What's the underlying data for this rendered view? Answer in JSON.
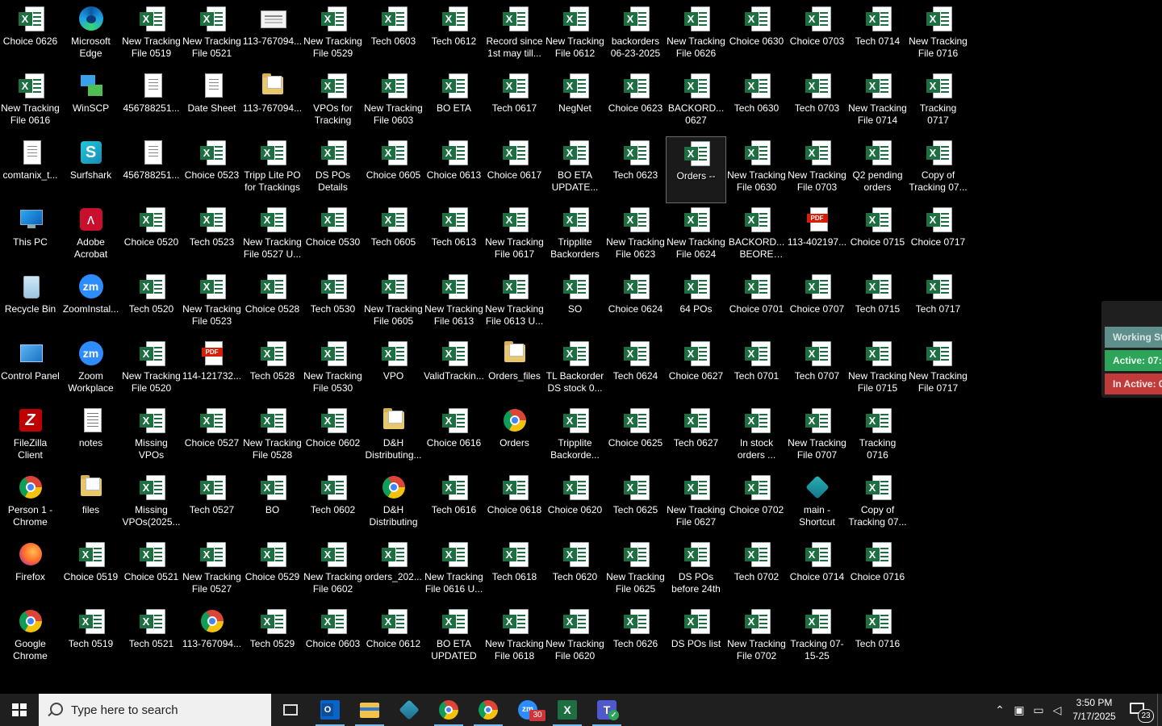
{
  "desktop": {
    "columns": [
      [
        {
          "label": "Choice 0626",
          "type": "excel"
        },
        {
          "label": "New Tracking File 0616",
          "type": "excel"
        },
        {
          "label": "comtanix_t...",
          "type": "file"
        },
        {
          "label": "This PC",
          "type": "pc"
        },
        {
          "label": "Recycle Bin",
          "type": "recycle"
        },
        {
          "label": "Control Panel",
          "type": "cp"
        },
        {
          "label": "FileZilla Client",
          "type": "fz"
        },
        {
          "label": "Person 1 - Chrome",
          "type": "chrome"
        },
        {
          "label": "Firefox",
          "type": "ff"
        },
        {
          "label": "Google Chrome",
          "type": "chrome"
        }
      ],
      [
        {
          "label": "Microsoft Edge",
          "type": "edge"
        },
        {
          "label": "WinSCP",
          "type": "winscp"
        },
        {
          "label": "Surfshark",
          "type": "surf"
        },
        {
          "label": "Adobe Acrobat",
          "type": "acrobat"
        },
        {
          "label": "ZoomInstal...",
          "type": "zoom"
        },
        {
          "label": "Zoom Workplace",
          "type": "zoom"
        },
        {
          "label": "notes",
          "type": "notes"
        },
        {
          "label": "files",
          "type": "folder"
        },
        {
          "label": "Choice 0519",
          "type": "excel"
        },
        {
          "label": "Tech 0519",
          "type": "excel"
        }
      ],
      [
        {
          "label": "New Tracking File 0519",
          "type": "excel"
        },
        {
          "label": "456788251...",
          "type": "file"
        },
        {
          "label": "456788251...",
          "type": "file"
        },
        {
          "label": "Choice 0520",
          "type": "excel"
        },
        {
          "label": "Tech 0520",
          "type": "excel"
        },
        {
          "label": "New Tracking File 0520",
          "type": "excel"
        },
        {
          "label": "Missing VPOs",
          "type": "excel"
        },
        {
          "label": "Missing VPOs(2025...",
          "type": "excel"
        },
        {
          "label": "Choice 0521",
          "type": "excel"
        },
        {
          "label": "Tech 0521",
          "type": "excel"
        }
      ],
      [
        {
          "label": "New Tracking File 0521",
          "type": "excel"
        },
        {
          "label": "Date Sheet",
          "type": "file"
        },
        {
          "label": "Choice 0523",
          "type": "excel"
        },
        {
          "label": "Tech 0523",
          "type": "excel"
        },
        {
          "label": "New Tracking File 0523",
          "type": "excel"
        },
        {
          "label": "114-121732...",
          "type": "pdf"
        },
        {
          "label": "Choice 0527",
          "type": "excel"
        },
        {
          "label": "Tech 0527",
          "type": "excel"
        },
        {
          "label": "New Tracking File 0527",
          "type": "excel"
        },
        {
          "label": "113-767094...",
          "type": "chrome"
        }
      ],
      [
        {
          "label": "113-767094...",
          "type": "img"
        },
        {
          "label": "113-767094...",
          "type": "folder"
        },
        {
          "label": "Tripp Lite PO for Trackings",
          "type": "excel"
        },
        {
          "label": "New Tracking File 0527 U...",
          "type": "excel"
        },
        {
          "label": "Choice 0528",
          "type": "excel"
        },
        {
          "label": "Tech 0528",
          "type": "excel"
        },
        {
          "label": "New Tracking File 0528",
          "type": "excel"
        },
        {
          "label": "BO",
          "type": "excel"
        },
        {
          "label": "Choice 0529",
          "type": "excel"
        },
        {
          "label": "Tech 0529",
          "type": "excel"
        }
      ],
      [
        {
          "label": "New Tracking File 0529",
          "type": "excel"
        },
        {
          "label": "VPOs for Tracking",
          "type": "excel"
        },
        {
          "label": "DS POs Details",
          "type": "excel"
        },
        {
          "label": "Choice 0530",
          "type": "excel"
        },
        {
          "label": "Tech 0530",
          "type": "excel"
        },
        {
          "label": "New Tracking File 0530",
          "type": "excel"
        },
        {
          "label": "Choice 0602",
          "type": "excel"
        },
        {
          "label": "Tech 0602",
          "type": "excel"
        },
        {
          "label": "New Tracking File 0602",
          "type": "excel"
        },
        {
          "label": "Choice 0603",
          "type": "excel"
        }
      ],
      [
        {
          "label": "Tech 0603",
          "type": "excel"
        },
        {
          "label": "New Tracking File 0603",
          "type": "excel"
        },
        {
          "label": "Choice 0605",
          "type": "excel"
        },
        {
          "label": "Tech 0605",
          "type": "excel"
        },
        {
          "label": "New Tracking File 0605",
          "type": "excel"
        },
        {
          "label": "VPO",
          "type": "excel"
        },
        {
          "label": "D&H Distributing...",
          "type": "folder"
        },
        {
          "label": "D&H Distributing",
          "type": "chrome"
        },
        {
          "label": "orders_202...",
          "type": "excel"
        },
        {
          "label": "Choice 0612",
          "type": "excel"
        }
      ],
      [
        {
          "label": "Tech 0612",
          "type": "excel"
        },
        {
          "label": "BO ETA",
          "type": "excel"
        },
        {
          "label": "Choice 0613",
          "type": "excel"
        },
        {
          "label": "Tech 0613",
          "type": "excel"
        },
        {
          "label": "New Tracking File 0613",
          "type": "excel"
        },
        {
          "label": "ValidTrackin...",
          "type": "excel"
        },
        {
          "label": "Choice 0616",
          "type": "excel"
        },
        {
          "label": "Tech 0616",
          "type": "excel"
        },
        {
          "label": "New Tracking File 0616 U...",
          "type": "excel"
        },
        {
          "label": "BO ETA UPDATED",
          "type": "excel"
        }
      ],
      [
        {
          "label": "Record since 1st may till...",
          "type": "excel"
        },
        {
          "label": "Tech 0617",
          "type": "excel"
        },
        {
          "label": "Choice 0617",
          "type": "excel"
        },
        {
          "label": "New Tracking File 0617",
          "type": "excel"
        },
        {
          "label": "New Tracking File 0613 U...",
          "type": "excel"
        },
        {
          "label": "Orders_files",
          "type": "folder"
        },
        {
          "label": "Orders",
          "type": "chrome"
        },
        {
          "label": "Choice 0618",
          "type": "excel"
        },
        {
          "label": "Tech 0618",
          "type": "excel"
        },
        {
          "label": "New Tracking File 0618",
          "type": "excel"
        }
      ],
      [
        {
          "label": "New Tracking File 0612",
          "type": "excel"
        },
        {
          "label": "NegNet",
          "type": "excel"
        },
        {
          "label": "BO ETA UPDATE...",
          "type": "excel"
        },
        {
          "label": "Tripplite Backorders",
          "type": "excel"
        },
        {
          "label": "SO",
          "type": "excel"
        },
        {
          "label": "TL Backorder DS stock 0...",
          "type": "excel"
        },
        {
          "label": "Tripplite Backorde...",
          "type": "excel"
        },
        {
          "label": "Choice 0620",
          "type": "excel"
        },
        {
          "label": "Tech 0620",
          "type": "excel"
        },
        {
          "label": "New Tracking File 0620",
          "type": "excel"
        }
      ],
      [
        {
          "label": "backorders 06-23-2025",
          "type": "excel"
        },
        {
          "label": "Choice 0623",
          "type": "excel"
        },
        {
          "label": "Tech 0623",
          "type": "excel"
        },
        {
          "label": "New Tracking File 0623",
          "type": "excel"
        },
        {
          "label": "Choice 0624",
          "type": "excel"
        },
        {
          "label": "Tech 0624",
          "type": "excel"
        },
        {
          "label": "Choice 0625",
          "type": "excel"
        },
        {
          "label": "Tech 0625",
          "type": "excel"
        },
        {
          "label": "New Tracking File 0625",
          "type": "excel"
        },
        {
          "label": "Tech 0626",
          "type": "excel"
        }
      ],
      [
        {
          "label": "New Tracking File 0626",
          "type": "excel"
        },
        {
          "label": "BACKORD... 0627",
          "type": "excel"
        },
        {
          "label": "Orders --",
          "type": "excel",
          "selected": true
        },
        {
          "label": "New Tracking File 0624",
          "type": "excel"
        },
        {
          "label": "64 POs",
          "type": "excel"
        },
        {
          "label": "Choice 0627",
          "type": "excel"
        },
        {
          "label": "Tech 0627",
          "type": "excel"
        },
        {
          "label": "New Tracking File 0627",
          "type": "excel"
        },
        {
          "label": "DS POs before 24th",
          "type": "excel"
        },
        {
          "label": "DS POs list",
          "type": "excel"
        }
      ],
      [
        {
          "label": "Choice 0630",
          "type": "excel"
        },
        {
          "label": "Tech 0630",
          "type": "excel"
        },
        {
          "label": "New Tracking File 0630",
          "type": "excel"
        },
        {
          "label": "BACKORD... BEORE 23R...",
          "type": "excel"
        },
        {
          "label": "Choice 0701",
          "type": "excel"
        },
        {
          "label": "Tech 0701",
          "type": "excel"
        },
        {
          "label": "In stock orders ...",
          "type": "excel"
        },
        {
          "label": "Choice 0702",
          "type": "excel"
        },
        {
          "label": "Tech 0702",
          "type": "excel"
        },
        {
          "label": "New Tracking File 0702",
          "type": "excel"
        }
      ],
      [
        {
          "label": "Choice 0703",
          "type": "excel"
        },
        {
          "label": "Tech 0703",
          "type": "excel"
        },
        {
          "label": "New Tracking File 0703",
          "type": "excel"
        },
        {
          "label": "113-402197...",
          "type": "pdf"
        },
        {
          "label": "Choice 0707",
          "type": "excel"
        },
        {
          "label": "Tech 0707",
          "type": "excel"
        },
        {
          "label": "New Tracking File 0707",
          "type": "excel"
        },
        {
          "label": "main - Shortcut",
          "type": "short"
        },
        {
          "label": "Choice 0714",
          "type": "excel"
        },
        {
          "label": "Tracking 07-15-25",
          "type": "excel"
        }
      ],
      [
        {
          "label": "Tech 0714",
          "type": "excel"
        },
        {
          "label": "New Tracking File 0714",
          "type": "excel"
        },
        {
          "label": "Q2 pending orders",
          "type": "excel"
        },
        {
          "label": "Choice 0715",
          "type": "excel"
        },
        {
          "label": "Tech 0715",
          "type": "excel"
        },
        {
          "label": "New Tracking File 0715",
          "type": "excel"
        },
        {
          "label": "Tracking 0716",
          "type": "excel"
        },
        {
          "label": "Copy of Tracking 07...",
          "type": "excel"
        },
        {
          "label": "Choice 0716",
          "type": "excel"
        },
        {
          "label": "Tech 0716",
          "type": "excel"
        }
      ],
      [
        {
          "label": "New Tracking File 0716",
          "type": "excel"
        },
        {
          "label": "Tracking 0717",
          "type": "excel"
        },
        {
          "label": "Copy of Tracking 07...",
          "type": "excel"
        },
        {
          "label": "Choice 0717",
          "type": "excel"
        },
        {
          "label": "Tech 0717",
          "type": "excel"
        },
        {
          "label": "New Tracking File 0717",
          "type": "excel"
        }
      ]
    ]
  },
  "widget": {
    "working": "Working St",
    "active": "Active: 07:",
    "inactive": "In Active: 0"
  },
  "taskbar": {
    "search_placeholder": "Type here to search",
    "apps": [
      {
        "name": "task-view-button",
        "kind": "taskview"
      },
      {
        "name": "outlook-button",
        "kind": "outlook",
        "active": true
      },
      {
        "name": "file-explorer-button",
        "kind": "explorer",
        "active": true
      },
      {
        "name": "app-button",
        "kind": "app"
      },
      {
        "name": "chrome-button",
        "kind": "chrome",
        "active": true
      },
      {
        "name": "chrome-profile-button",
        "kind": "chrome",
        "active": true
      },
      {
        "name": "zoom-button",
        "kind": "zoom",
        "badge": "30"
      },
      {
        "name": "excel-button",
        "kind": "excel",
        "active": true
      },
      {
        "name": "teams-button",
        "kind": "teams",
        "active": true
      }
    ],
    "time": "3:50 PM",
    "date": "7/17/2025",
    "notification_count": "23",
    "tray_icons": [
      "chevron-up-icon",
      "security-icon",
      "network-icon",
      "volume-icon"
    ]
  }
}
